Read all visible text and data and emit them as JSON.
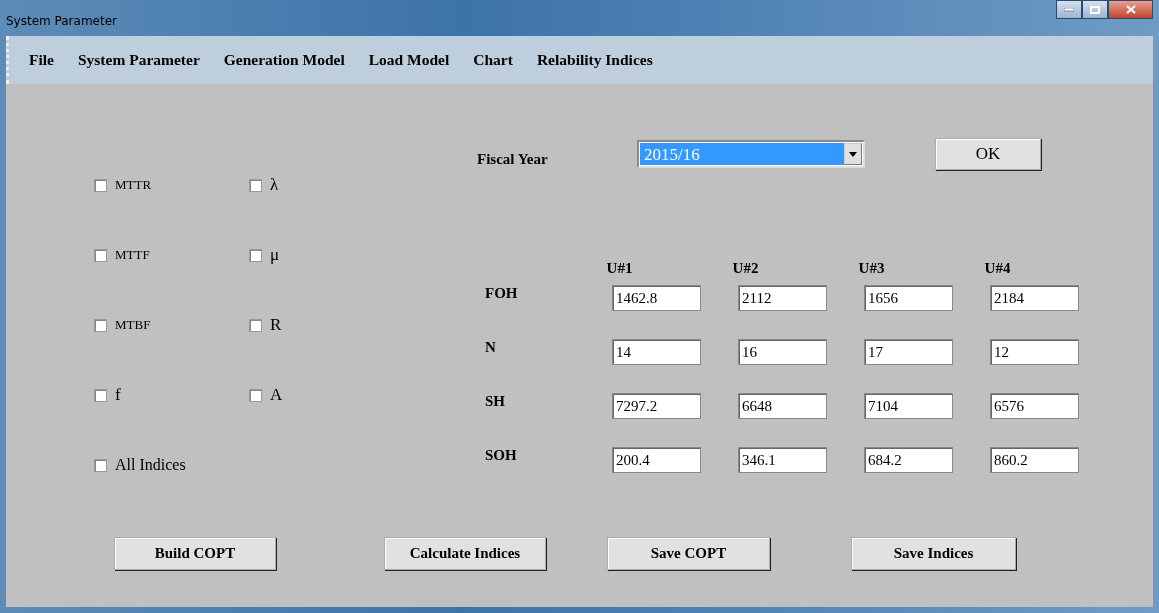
{
  "window": {
    "title": "System Parameter"
  },
  "menu": [
    "File",
    "System Parameter",
    "Generation Model",
    "Load Model",
    "Chart",
    "Relability Indices"
  ],
  "indices": [
    {
      "label": "MTTR",
      "checked": false,
      "small": true
    },
    {
      "label": "λ",
      "checked": false,
      "small": false
    },
    {
      "label": "MTTF",
      "checked": false,
      "small": true
    },
    {
      "label": "μ",
      "checked": false,
      "small": false
    },
    {
      "label": "MTBF",
      "checked": false,
      "small": true
    },
    {
      "label": "R",
      "checked": false,
      "small": false
    },
    {
      "label": "f",
      "checked": false,
      "small": false
    },
    {
      "label": "A",
      "checked": false,
      "small": false
    }
  ],
  "all_indices": {
    "label": "All Indices",
    "checked": false
  },
  "fiscal_year": {
    "label": "Fiscal Year",
    "value": "2015/16",
    "ok": "OK"
  },
  "units": [
    "U#1",
    "U#2",
    "U#3",
    "U#4"
  ],
  "rows": [
    {
      "label": "FOH",
      "values": [
        "1462.8",
        "2112",
        "1656",
        "2184"
      ]
    },
    {
      "label": "N",
      "values": [
        "14",
        "16",
        "17",
        "12"
      ]
    },
    {
      "label": "SH",
      "values": [
        "7297.2",
        "6648",
        "7104",
        "6576"
      ]
    },
    {
      "label": "SOH",
      "values": [
        "200.4",
        "346.1",
        "684.2",
        "860.2"
      ]
    }
  ],
  "buttons": [
    "Build COPT",
    "Calculate Indices",
    "Save COPT",
    "Save Indices"
  ]
}
